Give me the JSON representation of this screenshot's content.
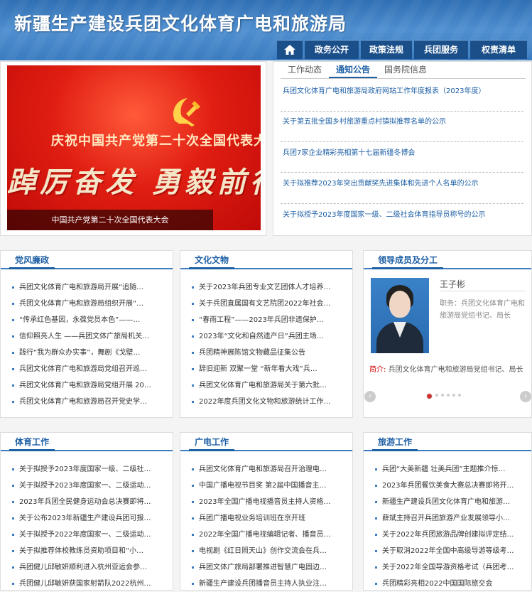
{
  "site": {
    "title": "新疆生产建设兵团文化体育广电和旅游局"
  },
  "nav": {
    "items": [
      "政务公开",
      "政策法规",
      "兵团服务",
      "权责清单"
    ]
  },
  "banner": {
    "line1": "庆祝中国共产党第二十次全国代表大会",
    "line2": "踔厉奋发 勇毅前行 团",
    "caption": "中国共产党第二十次全国代表大会"
  },
  "tabs": {
    "items": [
      "工作动态",
      "通知公告",
      "国务院信息"
    ],
    "active": 1
  },
  "notices": [
    "兵团文化体育广电和旅游局政府网站工作年度报表（2023年度）",
    "关于第五批全国乡村旅游重点村镇拟推荐名单的公示",
    "兵团7家企业精彩亮相第十七届新疆冬博会",
    "关于拟推荐2023年突出贡献奖先进集体和先进个人名单的公示",
    "关于拟授予2023年度国家一级、二级社会体育指导员称号的公示"
  ],
  "sections": {
    "party": {
      "title": "党风廉政",
      "items": [
        "兵团文化体育广电和旅游局开展“追随…",
        "兵团文化体育广电和旅游局组织开展“…",
        "“传承红色基因，永葆党员本色”——…",
        "信仰照亮人生 ——兵团文体广旅局机关…",
        "践行“我为群众办实事”，舞剧《戈壁…",
        "兵团文化体育广电和旅游局党组召开巡…",
        "兵团文化体育广电和旅游局党组开展 20…",
        "兵团文化体育广电和旅游局召开党史学…"
      ]
    },
    "culture": {
      "title": "文化文物",
      "items": [
        "关于2023年兵团专业文艺团体人才培养…",
        "关于兵团直属国有文艺院团2022年社会…",
        "“春雨工程”——2023年兵团非遗保护…",
        "2023年“文化和自然遗产日”兵团主场…",
        "兵团精神展陈馆文物藏品征集公告",
        "辞旧迎新 双聚一堂 “新年看大戏”兵…",
        "兵团文化体育广电和旅游局关于第六批…",
        "2022年度兵团文化文物和旅游统计工作…"
      ]
    },
    "leaders": {
      "title": "领导成员及分工",
      "name": "王子彬",
      "duty": "职务：兵团文化体育广电和旅游局党组书记、局长",
      "intro_label": "简介:",
      "intro": "兵团文化体育广电和旅游局党组书记、局长",
      "prev": "‹",
      "next": "›"
    },
    "sports": {
      "title": "体育工作",
      "items": [
        "关于拟授予2023年度国家一级、二级社…",
        "关于拟授予2023年度国家一、二级运动…",
        "2023年兵团全民健身运动会总决赛即将…",
        "关于公布2023年新疆生产建设兵团可报…",
        "关于拟授予2022年度国家一、二级运动…",
        "关于拟推荐体校教练员资助项目和“小…",
        "兵团健儿邱敏妍顺利进入杭州亚运会参…",
        "兵团健儿邱敏妍获国家射箭队2022杭州…"
      ]
    },
    "broadcast": {
      "title": "广电工作",
      "items": [
        "兵团文化体育广电和旅游局召开治理电…",
        "中国广播电视节目奖 第2届中国播音主…",
        "2023年全国广播电视播音员主持人资格…",
        "兵团广播电视业务培训班在京开班",
        "2022年全国广播电视编辑记者、播音员…",
        "电视剧《红日照天山》创作交流会在兵…",
        "兵团文体广旅局部署推进智慧广电固边…",
        "新疆生产建设兵团播音员主持人执业注…"
      ]
    },
    "tourism": {
      "title": "旅游工作",
      "items": [
        "兵团“大美新疆 壮美兵团”主题推介惊…",
        "2023年兵团餐饮美食大赛总决赛即将开…",
        "新疆生产建设兵团文化体育广电和旅游…",
        "薛斌主持召开兵团旅游产业发展领导小…",
        "关于2022年兵团旅游品牌创建拟评定结…",
        "关于取消2022年全国中高级导游等级考…",
        "关于2022年全国导游资格考试（兵团考…",
        "兵团精彩亮相2022中国国际旅交会"
      ]
    }
  },
  "colors": {
    "brand": "#1d5fa5",
    "banner_red": "#e01e12"
  }
}
